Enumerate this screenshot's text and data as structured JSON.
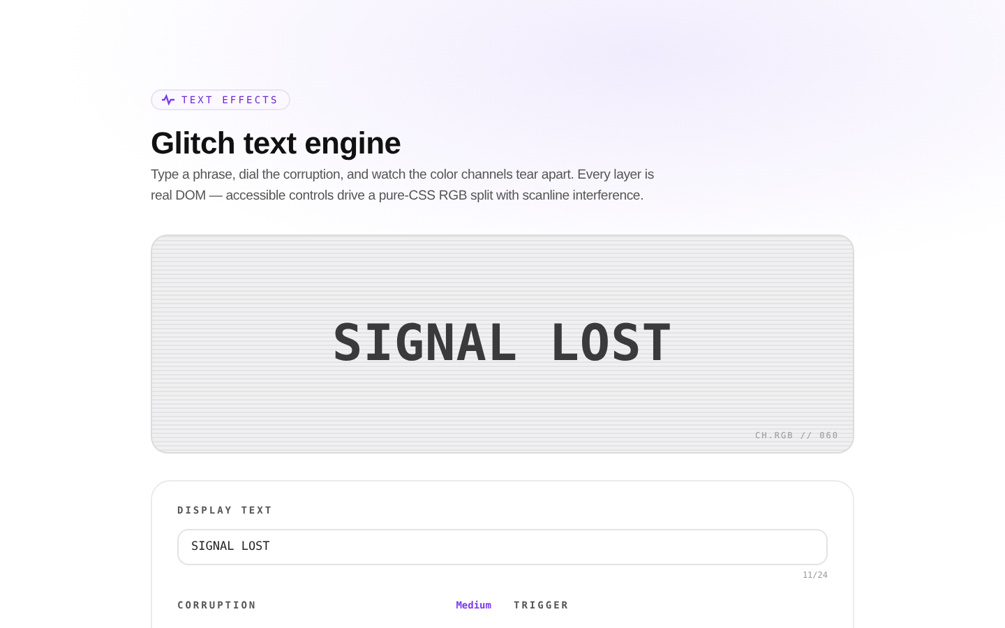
{
  "badge": {
    "label": "TEXT EFFECTS"
  },
  "title": "Glitch text engine",
  "description": "Type a phrase, dial the corruption, and watch the color channels tear apart. Every layer is real DOM — accessible controls drive a pure-CSS RGB split with scanline interference.",
  "preview": {
    "text": "SIGNAL LOST",
    "channel_tag": "CH.RGB // 060"
  },
  "controls": {
    "display_text": {
      "label": "DISPLAY TEXT",
      "value": "SIGNAL LOST",
      "counter": "11/24"
    },
    "corruption": {
      "label": "CORRUPTION",
      "value": "Medium"
    },
    "trigger": {
      "label": "TRIGGER"
    }
  }
}
